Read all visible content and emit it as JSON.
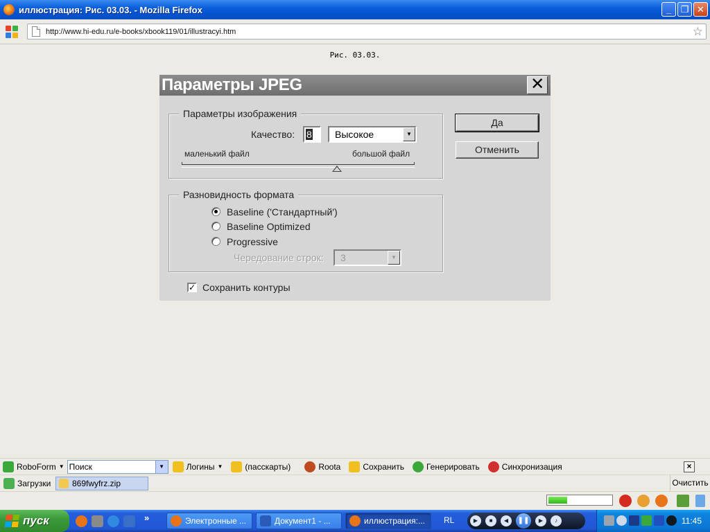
{
  "window": {
    "title": "иллюстрация: Рис. 03.03. - Mozilla Firefox",
    "minimize": "_",
    "restore": "❐",
    "close": "✕"
  },
  "nav": {
    "url": "http://www.hi-edu.ru/e-books/xbook119/01/illustracyi.htm"
  },
  "page": {
    "caption": "Рис. 03.03."
  },
  "dialog": {
    "title": "Параметры JPEG",
    "close": "✕",
    "image_group": {
      "legend": "Параметры изображения",
      "quality_label": "Качество:",
      "quality_value": "8",
      "quality_preset": "Высокое",
      "small_file": "маленький файл",
      "large_file": "большой файл",
      "slider_value": 8,
      "slider_max": 12
    },
    "format_group": {
      "legend": "Разновидность формата",
      "options": [
        "Baseline ('Стандартный')",
        "Baseline Optimized",
        "Progressive"
      ],
      "selected_index": 0,
      "scans_label": "Чередование строк:",
      "scans_value": "3"
    },
    "save_paths_label": "Сохранить контуры",
    "save_paths_checked": true,
    "ok": "Да",
    "cancel": "Отменить"
  },
  "roboform": {
    "brand": "RoboForm",
    "search_placeholder": "Поиск",
    "logins": "Логины",
    "passcards": "(пасскарты)",
    "roota": "Roota",
    "save": "Сохранить",
    "generate": "Генерировать",
    "sync": "Синхронизация"
  },
  "downloads": {
    "label": "Загрузки",
    "file": "869fwyfrz.zip",
    "clear": "Очистить"
  },
  "status": {
    "progress": 0.3
  },
  "taskbar": {
    "start": "пуск",
    "tasks": [
      "Электронные ...",
      "Документ1 - ...",
      "иллюстрация:..."
    ],
    "active_task": 2,
    "lang": "RL",
    "chevron": "»",
    "clock": "11:45"
  },
  "colors": {
    "xp_blue": "#245edb",
    "start_green": "#3c9a3a",
    "dialog_gray": "#d6d6d6"
  }
}
